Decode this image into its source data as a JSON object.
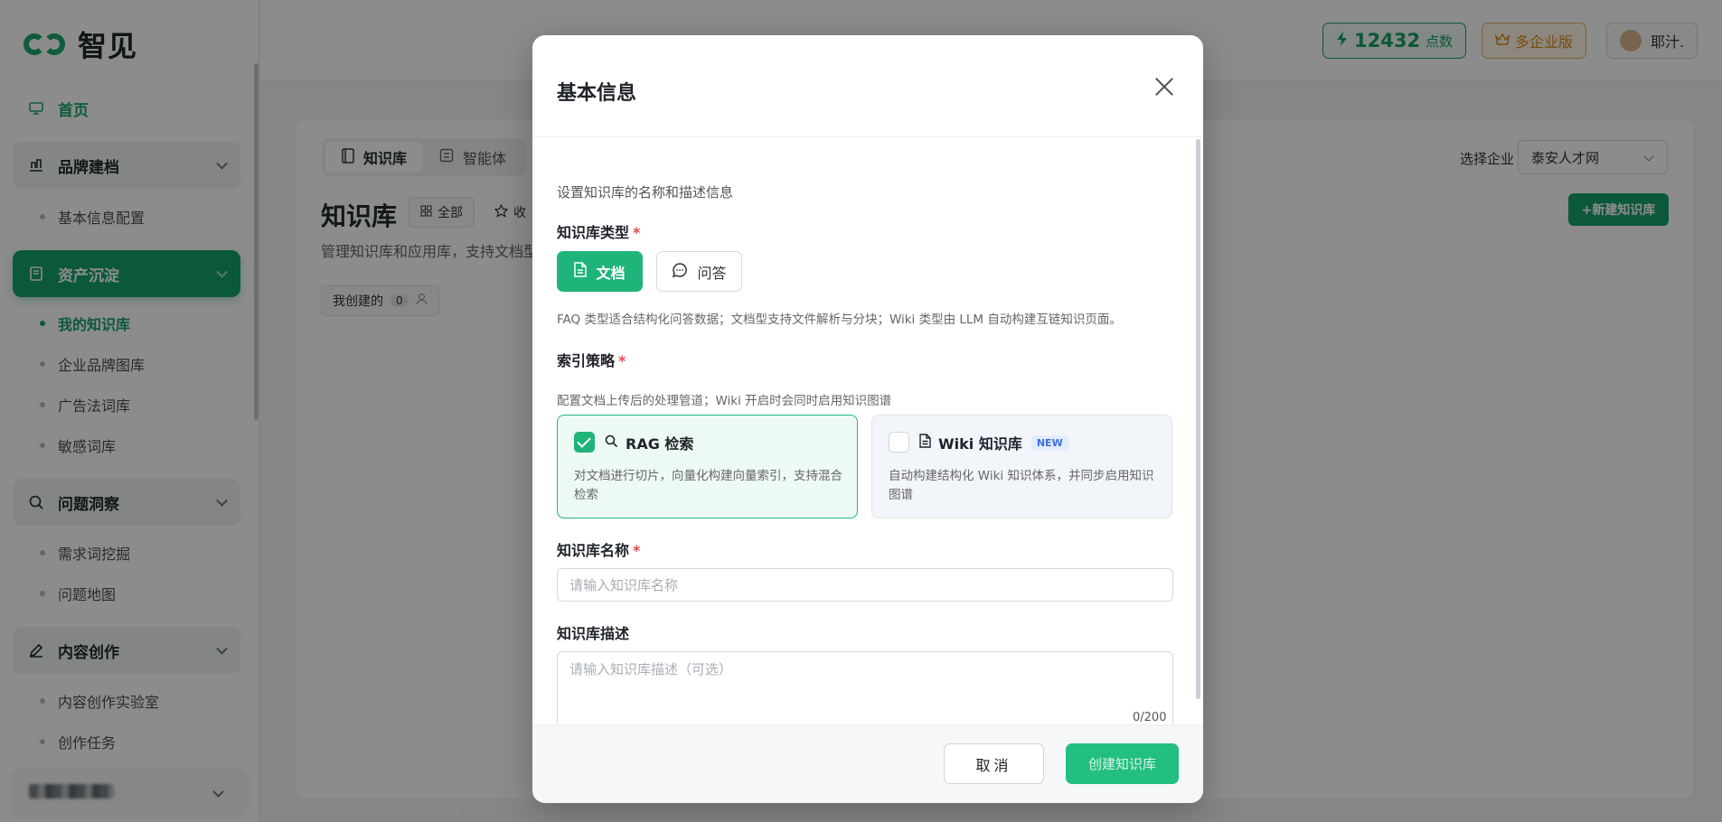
{
  "brand": {
    "name": "智见"
  },
  "sidebar": {
    "home": "首页",
    "groups": [
      {
        "label": "品牌建档",
        "items": [
          "基本信息配置"
        ]
      },
      {
        "label": "资产沉淀",
        "items": [
          "我的知识库",
          "企业品牌图库",
          "广告法词库",
          "敏感词库"
        ]
      },
      {
        "label": "问题洞察",
        "items": [
          "需求词挖掘",
          "问题地图"
        ]
      },
      {
        "label": "内容创作",
        "items": [
          "内容创作实验室",
          "创作任务"
        ]
      }
    ],
    "active_item": "我的知识库"
  },
  "topbar": {
    "points_value": "12432",
    "points_unit": "点数",
    "enterprise_label": "多企业版",
    "user_name": "耶汁."
  },
  "main": {
    "tabs": [
      "知识库",
      "智能体"
    ],
    "title": "知识库",
    "filter_all": "全部",
    "filter_fav": "收",
    "description": "管理知识库和应用库，支持文档型",
    "mine_label": "我创建的",
    "mine_count": "0",
    "enterprise_select_label": "选择企业",
    "enterprise_selected": "泰安人才网",
    "new_button": "+新建知识库"
  },
  "modal": {
    "title": "基本信息",
    "subtitle": "设置知识库的名称和描述信息",
    "type_label": "知识库类型",
    "type_options": [
      "文档",
      "问答"
    ],
    "type_hint": "FAQ 类型适合结构化问答数据；文档型支持文件解析与分块；Wiki 类型由 LLM 自动构建互链知识页面。",
    "index_label": "索引策略",
    "index_hint": "配置文档上传后的处理管道；Wiki 开启时会同时启用知识图谱",
    "strategies": [
      {
        "title": "RAG 检索",
        "desc": "对文档进行切片，向量化构建向量索引，支持混合检索",
        "checked": true
      },
      {
        "title": "Wiki 知识库",
        "badge": "NEW",
        "desc": "自动构建结构化 Wiki 知识体系，并同步启用知识图谱",
        "checked": false
      }
    ],
    "name_label": "知识库名称",
    "name_placeholder": "请输入知识库名称",
    "desc_label": "知识库描述",
    "desc_placeholder": "请输入知识库描述（可选）",
    "counter": "0/200",
    "cancel": "取消",
    "create": "创建知识库"
  },
  "colors": {
    "brand_green": "#15a06a",
    "accent_green": "#1fb57a",
    "required_red": "#e5484d"
  }
}
